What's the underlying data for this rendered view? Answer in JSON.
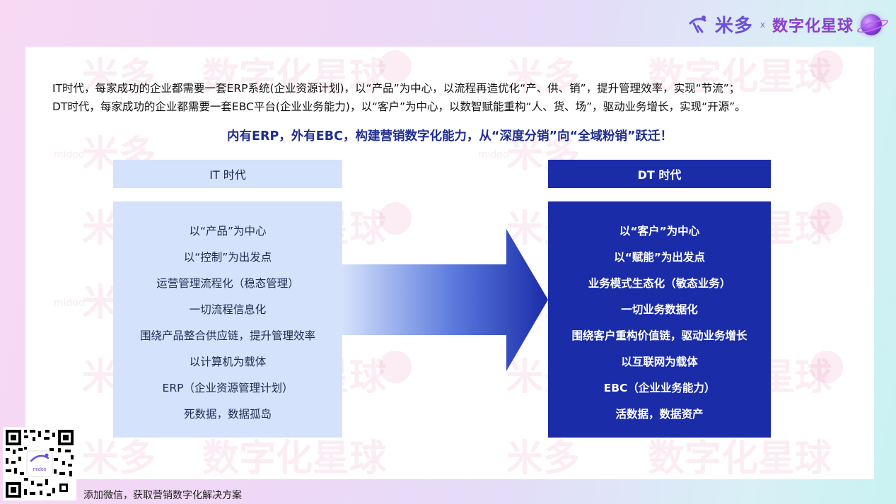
{
  "brand": {
    "logo_text": "米多",
    "logo_sub": "midoo",
    "separator": "x",
    "planet_text": "数字化星球"
  },
  "watermark": {
    "logo": "米多",
    "planet": "数字化星球",
    "sub": "midoo",
    "sep": "x"
  },
  "intro": {
    "line1": "IT时代，每家成功的企业都需要一套ERP系统(企业资源计划)，以“产品”为中心，以流程再造优化“产、供、销”，提升管理效率，实现“节流”；",
    "line2": "DT时代，每家成功的企业都需要一套EBC平台(企业业务能力)，以“客户”为中心，以数智赋能重构“人、货、场”，驱动业务增长，实现“开源”。"
  },
  "headline": "内有ERP，外有EBC，构建营销数字化能力，从“深度分销”向“全域粉销”跃迁！",
  "it": {
    "title": "IT 时代",
    "items": [
      "以“产品”为中心",
      "以“控制”为出发点",
      "运营管理流程化（稳态管理）",
      "一切流程信息化",
      "围绕产品整合供应链，提升管理效率",
      "以计算机为载体",
      "ERP（企业资源管理计划）",
      "死数据，数据孤岛"
    ]
  },
  "dt": {
    "title": "DT 时代",
    "items": [
      "以“客户”为中心",
      "以“赋能”为出发点",
      "业务模式生态化（敏态业务）",
      "一切业务数据化",
      "围绕客户重构价值链，驱动业务增长",
      "以互联网为载体",
      "EBC（企业业务能力）",
      "活数据，数据资产"
    ]
  },
  "footer": {
    "qr_caption": "添加微信，获取营销数字化解决方案",
    "qr_center_label": "midoo"
  },
  "colors": {
    "accent_dark": "#1a2ca8",
    "accent_light": "#d5e2fb",
    "headline": "#1f2d8f",
    "brand_purple": "#6b4fd8"
  },
  "icons": {
    "brand_mark": "midoo-logo-icon",
    "planet": "planet-icon",
    "arrow": "right-arrow-icon",
    "qr": "qr-code-icon"
  }
}
